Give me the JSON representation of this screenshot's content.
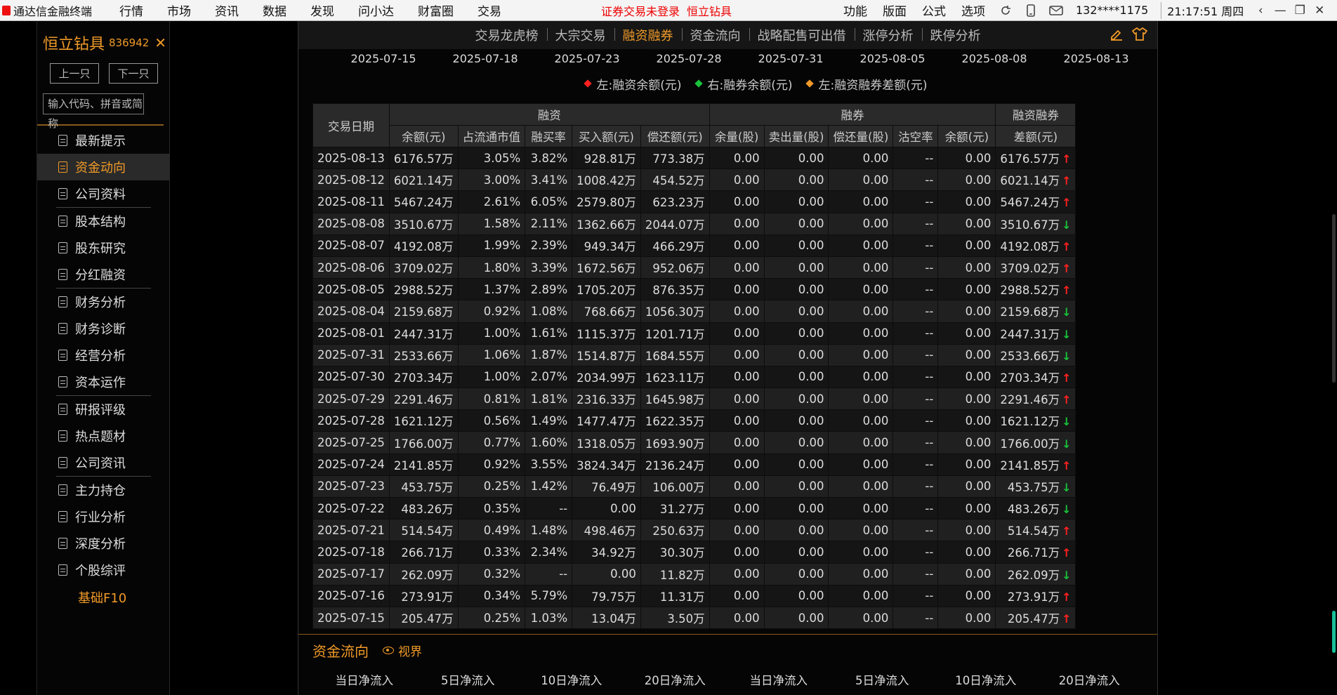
{
  "menubar": {
    "app_name": "通达信金融终端",
    "items": [
      "行情",
      "市场",
      "资讯",
      "数据",
      "发现",
      "问小达",
      "财富圈",
      "交易"
    ],
    "notice": "证券交易未登录",
    "notice_stock": "恒立钻具",
    "right_items": [
      "功能",
      "版面",
      "公式",
      "选项"
    ],
    "user": "132****1175",
    "clock": "21:17:51 周四"
  },
  "sidebar": {
    "stock_name": "恒立钻具",
    "stock_code": "836942",
    "close_glyph": "✕",
    "prev_label": "上一只",
    "next_label": "下一只",
    "search_placeholder": "输入代码、拼音或简称",
    "groups": [
      [
        "最新提示",
        "资金动向",
        "公司资料"
      ],
      [
        "股本结构",
        "股东研究",
        "分红融资"
      ],
      [
        "财务分析",
        "财务诊断",
        "经营分析",
        "资本运作"
      ],
      [
        "研报评级",
        "热点题材",
        "公司资讯"
      ],
      [
        "主力持仓",
        "行业分析",
        "深度分析",
        "个股综评"
      ]
    ],
    "active_item": "资金动向",
    "basic_f10": "基础F10"
  },
  "tabs": {
    "items": [
      "交易龙虎榜",
      "大宗交易",
      "融资融券",
      "资金流向",
      "战略配售可出借",
      "涨停分析",
      "跌停分析"
    ],
    "active": "融资融券"
  },
  "chart_axis": {
    "x_ticks": [
      "2025-07-15",
      "2025-07-18",
      "2025-07-23",
      "2025-07-28",
      "2025-07-31",
      "2025-08-05",
      "2025-08-08",
      "2025-08-13"
    ]
  },
  "legend": [
    {
      "label": "左:融资余额(元)",
      "color": "#ff2020"
    },
    {
      "label": "右:融券余额(元)",
      "color": "#19c23a"
    },
    {
      "label": "左:融资融券差额(元)",
      "color": "#f09a28"
    }
  ],
  "table": {
    "h_date": "交易日期",
    "h_margin": "融资",
    "h_short": "融券",
    "h_diff_top": "融资融券",
    "h_diff_bottom": "差额(元)",
    "sub_headers": [
      "余额(元)",
      "占流通市值",
      "融买率",
      "买入额(元)",
      "偿还额(元)",
      "余量(股)",
      "卖出量(股)",
      "偿还量(股)",
      "沽空率",
      "余额(元)"
    ],
    "rows": [
      [
        "2025-08-13",
        "6176.57万",
        "3.05%",
        "3.82%",
        "928.81万",
        "773.38万",
        "0.00",
        "0.00",
        "0.00",
        "--",
        "0.00",
        "6176.57万",
        "up"
      ],
      [
        "2025-08-12",
        "6021.14万",
        "3.00%",
        "3.41%",
        "1008.42万",
        "454.52万",
        "0.00",
        "0.00",
        "0.00",
        "--",
        "0.00",
        "6021.14万",
        "up"
      ],
      [
        "2025-08-11",
        "5467.24万",
        "2.61%",
        "6.05%",
        "2579.80万",
        "623.23万",
        "0.00",
        "0.00",
        "0.00",
        "--",
        "0.00",
        "5467.24万",
        "up"
      ],
      [
        "2025-08-08",
        "3510.67万",
        "1.58%",
        "2.11%",
        "1362.66万",
        "2044.07万",
        "0.00",
        "0.00",
        "0.00",
        "--",
        "0.00",
        "3510.67万",
        "down"
      ],
      [
        "2025-08-07",
        "4192.08万",
        "1.99%",
        "2.39%",
        "949.34万",
        "466.29万",
        "0.00",
        "0.00",
        "0.00",
        "--",
        "0.00",
        "4192.08万",
        "up"
      ],
      [
        "2025-08-06",
        "3709.02万",
        "1.80%",
        "3.39%",
        "1672.56万",
        "952.06万",
        "0.00",
        "0.00",
        "0.00",
        "--",
        "0.00",
        "3709.02万",
        "up"
      ],
      [
        "2025-08-05",
        "2988.52万",
        "1.37%",
        "2.89%",
        "1705.20万",
        "876.35万",
        "0.00",
        "0.00",
        "0.00",
        "--",
        "0.00",
        "2988.52万",
        "up"
      ],
      [
        "2025-08-04",
        "2159.68万",
        "0.92%",
        "1.08%",
        "768.66万",
        "1056.30万",
        "0.00",
        "0.00",
        "0.00",
        "--",
        "0.00",
        "2159.68万",
        "down"
      ],
      [
        "2025-08-01",
        "2447.31万",
        "1.00%",
        "1.61%",
        "1115.37万",
        "1201.71万",
        "0.00",
        "0.00",
        "0.00",
        "--",
        "0.00",
        "2447.31万",
        "down"
      ],
      [
        "2025-07-31",
        "2533.66万",
        "1.06%",
        "1.87%",
        "1514.87万",
        "1684.55万",
        "0.00",
        "0.00",
        "0.00",
        "--",
        "0.00",
        "2533.66万",
        "down"
      ],
      [
        "2025-07-30",
        "2703.34万",
        "1.00%",
        "2.07%",
        "2034.99万",
        "1623.11万",
        "0.00",
        "0.00",
        "0.00",
        "--",
        "0.00",
        "2703.34万",
        "up"
      ],
      [
        "2025-07-29",
        "2291.46万",
        "0.81%",
        "1.81%",
        "2316.33万",
        "1645.98万",
        "0.00",
        "0.00",
        "0.00",
        "--",
        "0.00",
        "2291.46万",
        "up"
      ],
      [
        "2025-07-28",
        "1621.12万",
        "0.56%",
        "1.49%",
        "1477.47万",
        "1622.35万",
        "0.00",
        "0.00",
        "0.00",
        "--",
        "0.00",
        "1621.12万",
        "down"
      ],
      [
        "2025-07-25",
        "1766.00万",
        "0.77%",
        "1.60%",
        "1318.05万",
        "1693.90万",
        "0.00",
        "0.00",
        "0.00",
        "--",
        "0.00",
        "1766.00万",
        "down"
      ],
      [
        "2025-07-24",
        "2141.85万",
        "0.92%",
        "3.55%",
        "3824.34万",
        "2136.24万",
        "0.00",
        "0.00",
        "0.00",
        "--",
        "0.00",
        "2141.85万",
        "up"
      ],
      [
        "2025-07-23",
        "453.75万",
        "0.25%",
        "1.42%",
        "76.49万",
        "106.00万",
        "0.00",
        "0.00",
        "0.00",
        "--",
        "0.00",
        "453.75万",
        "down"
      ],
      [
        "2025-07-22",
        "483.26万",
        "0.35%",
        "--",
        "0.00",
        "31.27万",
        "0.00",
        "0.00",
        "0.00",
        "--",
        "0.00",
        "483.26万",
        "down"
      ],
      [
        "2025-07-21",
        "514.54万",
        "0.49%",
        "1.48%",
        "498.46万",
        "250.63万",
        "0.00",
        "0.00",
        "0.00",
        "--",
        "0.00",
        "514.54万",
        "up"
      ],
      [
        "2025-07-18",
        "266.71万",
        "0.33%",
        "2.34%",
        "34.92万",
        "30.30万",
        "0.00",
        "0.00",
        "0.00",
        "--",
        "0.00",
        "266.71万",
        "up"
      ],
      [
        "2025-07-17",
        "262.09万",
        "0.32%",
        "--",
        "0.00",
        "11.82万",
        "0.00",
        "0.00",
        "0.00",
        "--",
        "0.00",
        "262.09万",
        "down"
      ],
      [
        "2025-07-16",
        "273.91万",
        "0.34%",
        "5.79%",
        "79.75万",
        "11.31万",
        "0.00",
        "0.00",
        "0.00",
        "--",
        "0.00",
        "273.91万",
        "up"
      ],
      [
        "2025-07-15",
        "205.47万",
        "0.25%",
        "1.03%",
        "13.04万",
        "3.50万",
        "0.00",
        "0.00",
        "0.00",
        "--",
        "0.00",
        "205.47万",
        "up"
      ]
    ]
  },
  "flow": {
    "title": "资金流向",
    "view_label": "视界",
    "headers": [
      "当日净流入",
      "5日净流入",
      "10日净流入",
      "20日净流入",
      "当日净流入",
      "5日净流入",
      "10日净流入",
      "20日净流入"
    ]
  }
}
